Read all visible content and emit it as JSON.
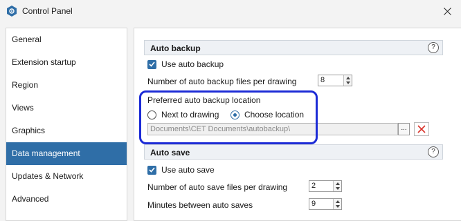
{
  "window": {
    "title": "Control Panel",
    "app_icon": "hexagon-gear-icon",
    "close_icon": "close-icon"
  },
  "sidebar": {
    "items": [
      {
        "label": "General",
        "selected": false
      },
      {
        "label": "Extension startup",
        "selected": false
      },
      {
        "label": "Region",
        "selected": false
      },
      {
        "label": "Views",
        "selected": false
      },
      {
        "label": "Graphics",
        "selected": false
      },
      {
        "label": "Data management",
        "selected": true
      },
      {
        "label": "Updates & Network",
        "selected": false
      },
      {
        "label": "Advanced",
        "selected": false
      }
    ]
  },
  "auto_backup": {
    "header": "Auto backup",
    "help": "?",
    "use_label": "Use auto backup",
    "use_checked": true,
    "files_label": "Number of auto backup files per drawing",
    "files_value": "8",
    "location_label": "Preferred auto backup location",
    "radio_next": "Next to drawing",
    "radio_choose": "Choose location",
    "selected_radio": "choose",
    "path_value": "Documents\\CET Documents\\autobackup\\",
    "browse_label": "..."
  },
  "auto_save": {
    "header": "Auto save",
    "help": "?",
    "use_label": "Use auto save",
    "use_checked": true,
    "files_label": "Number of auto save files per drawing",
    "files_value": "2",
    "minutes_label": "Minutes between auto saves",
    "minutes_value": "9"
  },
  "colors": {
    "accent": "#2f6ea7",
    "highlight": "#1c2bd6",
    "clear_red": "#d9342b"
  }
}
